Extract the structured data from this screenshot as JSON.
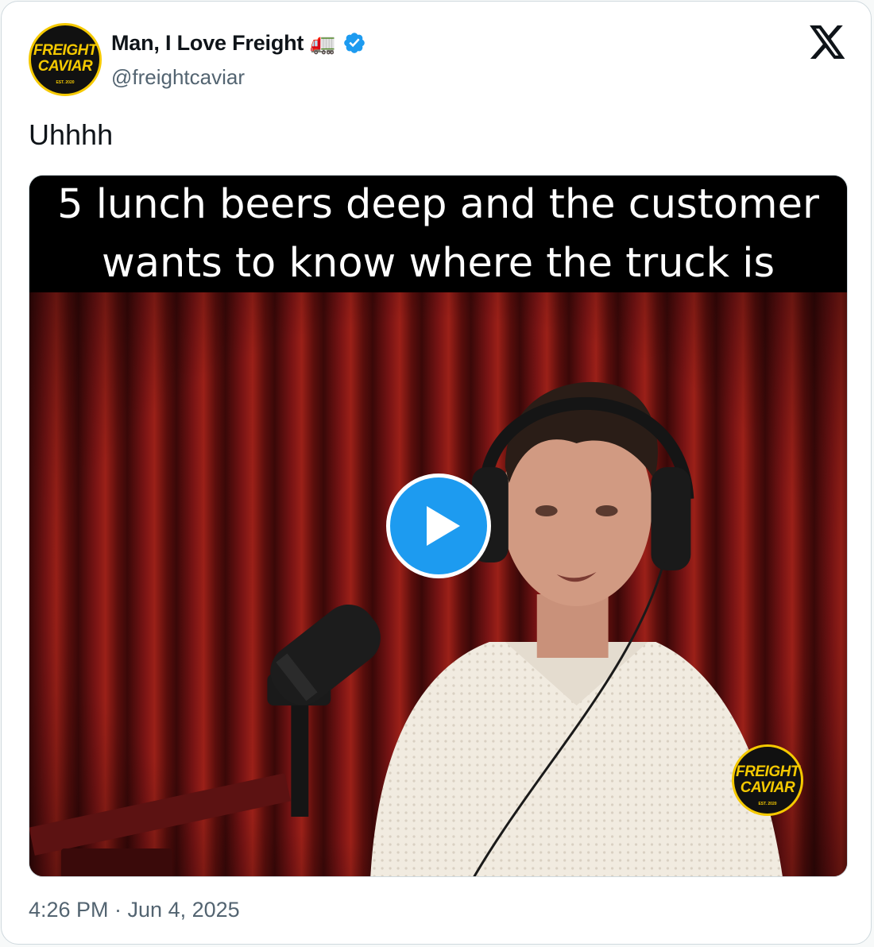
{
  "author": {
    "name": "Man, I Love Freight",
    "name_emoji": "🚛",
    "handle": "@freightcaviar",
    "verified": true,
    "avatar_lines": [
      "FREIGHT",
      "CAVIAR",
      "EST. 2020"
    ]
  },
  "tweet": {
    "text": "Uhhhh",
    "media_caption_line1": "5 lunch beers deep and the customer",
    "media_caption_line2": "wants to know where the truck is",
    "watermark_lines": [
      "FREIGHT",
      "CAVIAR",
      "EST. 2020"
    ]
  },
  "timestamp": "4:26 PM · Jun 4, 2025",
  "icons": {
    "platform": "x-logo-icon",
    "verified": "verified-badge-icon",
    "play": "play-icon"
  },
  "colors": {
    "brand_yellow": "#f5c900",
    "verified_blue": "#1d9bf0",
    "text_primary": "#0f1419",
    "text_secondary": "#536471"
  }
}
